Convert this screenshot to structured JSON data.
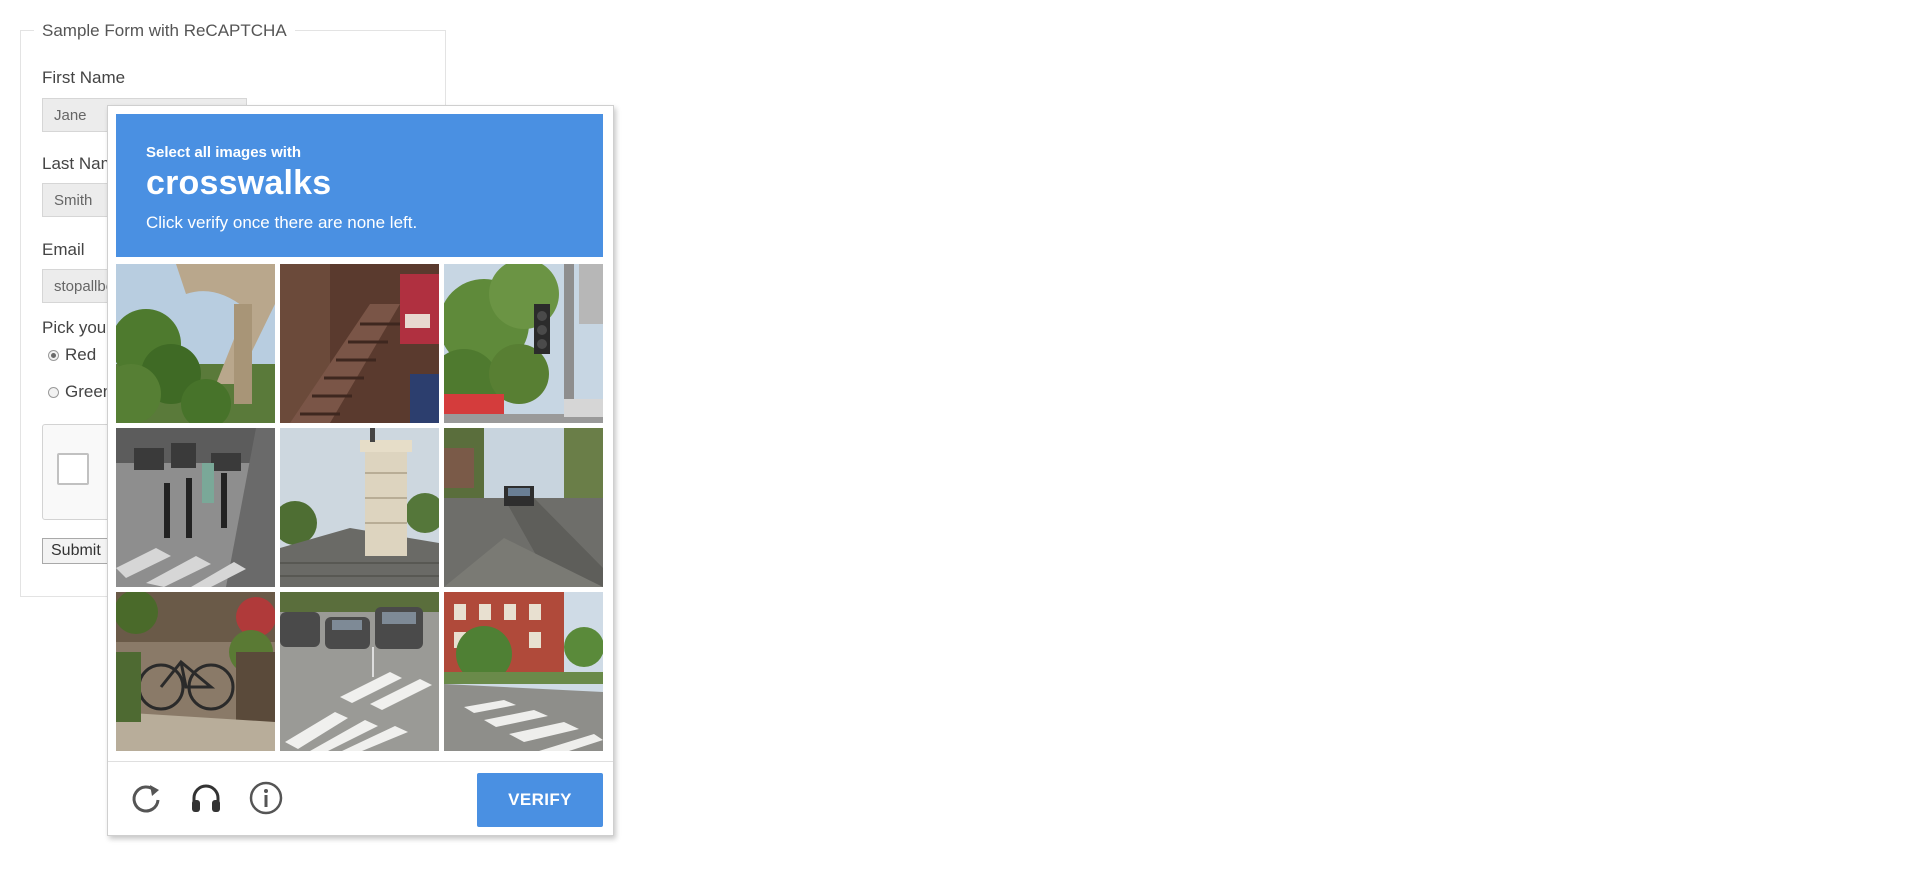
{
  "form": {
    "legend": "Sample Form with ReCAPTCHA",
    "first_name_label": "First Name",
    "first_name_value": "Jane",
    "last_name_label": "Last Name",
    "last_name_value": "Smith",
    "email_label": "Email",
    "email_value": "stopallbots@gmail.com",
    "color_label": "Pick your favorite color",
    "color_options": [
      "Red",
      "Green"
    ],
    "color_selected": "Red",
    "submit_label": "Submit"
  },
  "challenge": {
    "instruction_small": "Select all images with",
    "target": "crosswalks",
    "instruction_sub": "Click verify once there are none left.",
    "header_color": "#4a90e2",
    "grid": {
      "rows": 3,
      "cols": 3
    },
    "tiles": [
      {
        "row": 1,
        "col": 1,
        "scene": "bridge-arch-trees"
      },
      {
        "row": 1,
        "col": 2,
        "scene": "brownstone-stairs"
      },
      {
        "row": 1,
        "col": 3,
        "scene": "traffic-light-trees"
      },
      {
        "row": 2,
        "col": 1,
        "scene": "bollards-crosswalk"
      },
      {
        "row": 2,
        "col": 2,
        "scene": "chimney-roof"
      },
      {
        "row": 2,
        "col": 3,
        "scene": "road-car"
      },
      {
        "row": 3,
        "col": 1,
        "scene": "bicycles-plants"
      },
      {
        "row": 3,
        "col": 2,
        "scene": "parking-crosswalk"
      },
      {
        "row": 3,
        "col": 3,
        "scene": "brick-building-crosswalk"
      }
    ],
    "footer_icons": [
      "reload-icon",
      "audio-headphones-icon",
      "info-icon"
    ],
    "verify_label": "VERIFY"
  }
}
